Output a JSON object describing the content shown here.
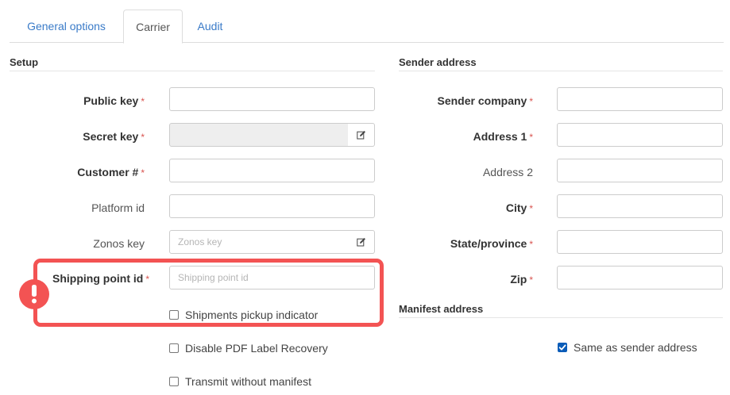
{
  "tabs": [
    {
      "label": "General options",
      "active": false
    },
    {
      "label": "Carrier",
      "active": true
    },
    {
      "label": "Audit",
      "active": false
    }
  ],
  "setup": {
    "title": "Setup",
    "public_key": {
      "label": "Public key",
      "required": "*",
      "value": ""
    },
    "secret_key": {
      "label": "Secret key",
      "required": "*",
      "value": "",
      "addon_icon": "edit-icon"
    },
    "customer_number": {
      "label": "Customer #",
      "required": "*",
      "value": ""
    },
    "platform_id": {
      "label": "Platform id",
      "value": ""
    },
    "zonos_key": {
      "label": "Zonos key",
      "placeholder": "Zonos key",
      "value": "",
      "addon_icon": "edit-icon"
    },
    "shipping_point_id": {
      "label": "Shipping point id",
      "required": "*",
      "placeholder": "Shipping point id",
      "value": ""
    },
    "shipments_pickup_indicator": {
      "label": "Shipments pickup indicator",
      "checked": false
    },
    "disable_pdf_label_recovery": {
      "label": "Disable PDF Label Recovery",
      "checked": false
    },
    "transmit_without_manifest": {
      "label": "Transmit without manifest",
      "checked": false
    }
  },
  "sender": {
    "title": "Sender address",
    "company": {
      "label": "Sender company",
      "required": "*",
      "value": ""
    },
    "address1": {
      "label": "Address 1",
      "required": "*",
      "value": ""
    },
    "address2": {
      "label": "Address 2",
      "value": ""
    },
    "city": {
      "label": "City",
      "required": "*",
      "value": ""
    },
    "state": {
      "label": "State/province",
      "required": "*",
      "value": ""
    },
    "zip": {
      "label": "Zip",
      "required": "*",
      "value": ""
    }
  },
  "manifest": {
    "title": "Manifest address",
    "same_as_sender": {
      "label": "Same as sender address",
      "checked": true
    }
  },
  "annotation": {
    "badge_icon": "exclamation-icon",
    "color": "#f35353"
  },
  "colors": {
    "link": "#3a7bc8",
    "required": "#d9534f",
    "checkbox_checked": "#0b5cb8"
  }
}
